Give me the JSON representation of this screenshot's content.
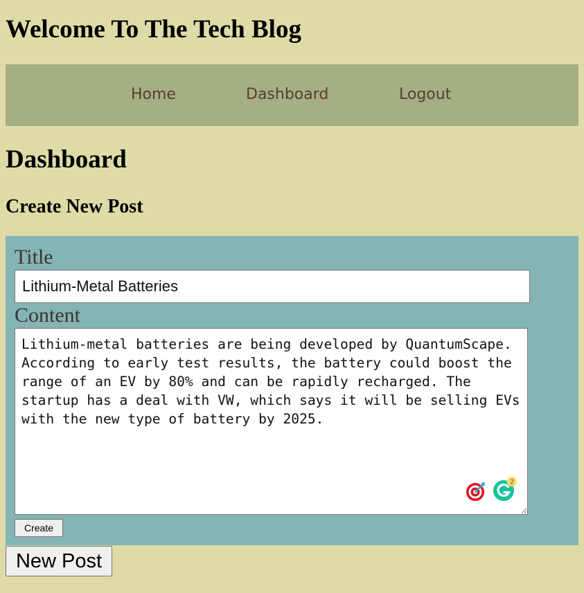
{
  "header": {
    "title": "Welcome To The Tech Blog"
  },
  "nav": {
    "items": [
      {
        "label": "Home"
      },
      {
        "label": "Dashboard"
      },
      {
        "label": "Logout"
      }
    ],
    "background_color": "#a4b083",
    "link_color": "#5a3a34"
  },
  "main": {
    "title": "Dashboard",
    "section_title": "Create New Post"
  },
  "form": {
    "title_label": "Title",
    "title_value": "Lithium-Metal Batteries",
    "content_label": "Content",
    "content_value": "Lithium-metal batteries are being developed by QuantumScape. According to early test results, the battery could boost the range of an EV by 80% and can be rapidly recharged. The startup has a deal with VW, which says it will be selling EVs with the new type of battery by 2025.",
    "create_label": "Create",
    "background_color": "#84b4b3",
    "extensions": {
      "target_icon": "target-icon",
      "grammarly_icon": "grammarly-icon",
      "grammarly_badge": "2"
    }
  },
  "new_post_label": "New Post",
  "colors": {
    "page_background": "#dfdba7"
  }
}
